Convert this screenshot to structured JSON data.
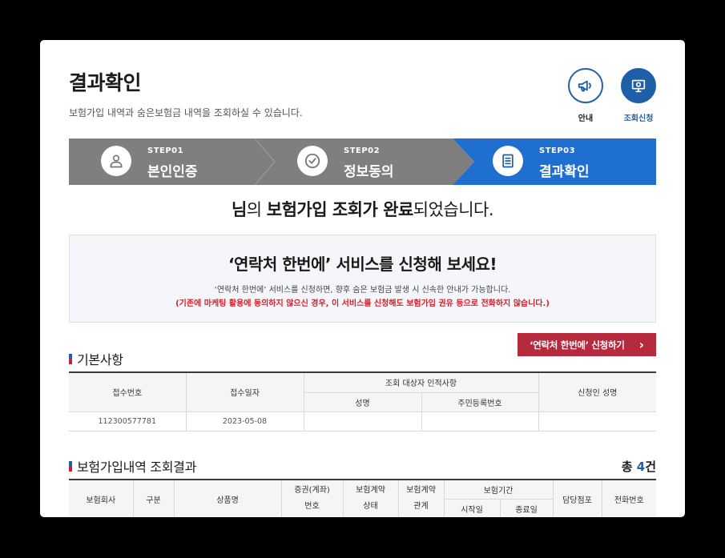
{
  "header": {
    "title": "결과확인",
    "subtitle": "보험가입 내역과 숨은보험금 내역을 조회하실 수 있습니다."
  },
  "quick_menu": {
    "guide_label": "안내",
    "guide_icon": "megaphone-icon",
    "request_label": "조회신청",
    "request_icon": "monitor-icon"
  },
  "steps": [
    {
      "num": "STEP01",
      "name": "본인인증",
      "icon": "user-icon",
      "state": "done"
    },
    {
      "num": "STEP02",
      "name": "정보동의",
      "icon": "check-circle-icon",
      "state": "done"
    },
    {
      "num": "STEP03",
      "name": "결과확인",
      "icon": "document-icon",
      "state": "active"
    }
  ],
  "result_message": {
    "name_suffix": "님",
    "part1": "의 ",
    "bold1": "보험가입 조회가 완료",
    "part2": "되었습니다."
  },
  "promo": {
    "title": "‘연락처 한번에’ 서비스를 신청해 보세요!",
    "description": "‘연락처 한번에’ 서비스를 신청하면, 향후 숨은 보험금 발생 시 신속한 안내가 가능합니다.",
    "notice": "(기존에 마케팅 활용에 동의하지 않으신 경우, 이 서비스를 신청해도 보험가입 권유 등으로 전화하지 않습니다.)"
  },
  "apply_button": {
    "label": "‘연락처 한번에’ 신청하기",
    "arrow": "›"
  },
  "basic_info": {
    "title": "기본사항",
    "headers": {
      "receipt_no": "접수번호",
      "receipt_date": "접수일자",
      "target_group": "조회 대상자 인적사항",
      "name": "성명",
      "resident_no": "주민등록번호",
      "applicant_name": "신청인 성명"
    },
    "row": {
      "receipt_no": "112300577781",
      "receipt_date": "2023-05-08",
      "name": "",
      "resident_no": "",
      "applicant_name": ""
    }
  },
  "results": {
    "title": "보험가입내역 조회결과",
    "total_prefix": "총 ",
    "total_count": "4",
    "total_suffix": "건",
    "headers": {
      "company": "보험회사",
      "category": "구분",
      "product": "상품명",
      "policy_no_1": "증권(계좌)",
      "policy_no_2": "번호",
      "status_1": "보험계약",
      "status_2": "상태",
      "relation_1": "보험계약",
      "relation_2": "관계",
      "period": "보험기간",
      "start": "시작일",
      "end": "종료일",
      "branch": "담당점포",
      "phone": "전화번호"
    }
  },
  "colors": {
    "primary": "#1f5fa8",
    "step_done": "#7f7f7f",
    "step_active": "#1f6fd1",
    "apply_button": "#b52a3d",
    "notice_red": "#d5202a"
  }
}
